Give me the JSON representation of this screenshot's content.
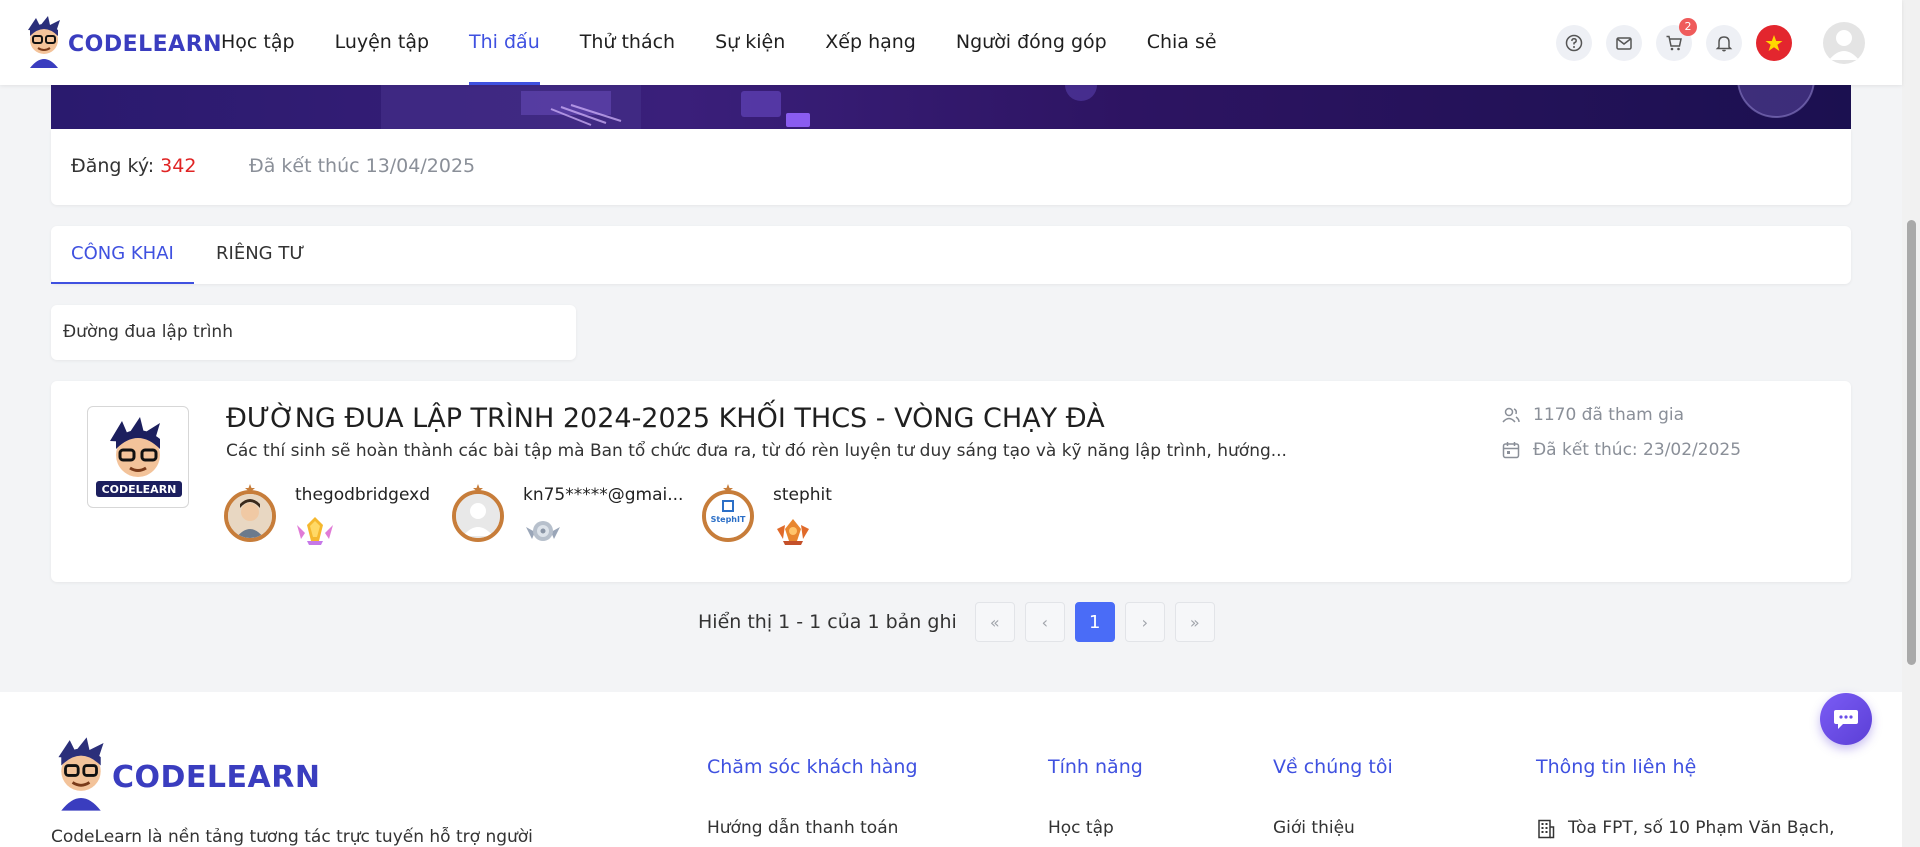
{
  "header": {
    "logo_text": "CODELEARN",
    "nav": [
      {
        "label": "Học tập"
      },
      {
        "label": "Luyện tập"
      },
      {
        "label": "Thi đấu",
        "active": true
      },
      {
        "label": "Thử thách"
      },
      {
        "label": "Sự kiện"
      },
      {
        "label": "Xếp hạng"
      },
      {
        "label": "Người đóng góp"
      },
      {
        "label": "Chia sẻ"
      }
    ],
    "cart_count": "2",
    "icons": [
      "help-icon",
      "mail-icon",
      "cart-icon",
      "bell-icon",
      "vn-flag-icon",
      "user-avatar-icon"
    ]
  },
  "registration": {
    "label": "Đăng ký:",
    "count": "342",
    "status": "Đã kết thúc 13/04/2025"
  },
  "tabs": [
    {
      "label": "CÔNG KHAI",
      "active": true
    },
    {
      "label": "RIÊNG TƯ"
    }
  ],
  "filter": {
    "value": "Đường đua lập trình"
  },
  "contest": {
    "title": "ĐƯỜNG ĐUA LẬP TRÌNH 2024-2025 KHỐI THCS - VÒNG CHẠY ĐÀ",
    "description": "Các thí sinh sẽ hoàn thành các bài tập mà Ban tổ chức đưa ra, từ đó rèn luyện tư duy sáng tạo và kỹ năng lập trình, hướng...",
    "participants": "1170 đã tham gia",
    "end_date": "Đã kết thúc: 23/02/2025",
    "winners": [
      {
        "name": "thegodbridgexd",
        "medal": "gold"
      },
      {
        "name": "kn75*****@gmai...",
        "medal": "silver"
      },
      {
        "name": "stephit",
        "medal": "bronze"
      }
    ]
  },
  "pagination": {
    "info": "Hiển thị 1 - 1 của 1 bản ghi",
    "current_page": "1",
    "first": "«",
    "prev": "‹",
    "next": "›",
    "last": "»"
  },
  "footer": {
    "logo_text": "CODELEARN",
    "about": "CodeLearn là nền tảng tương tác trực tuyến hỗ trợ người",
    "columns": [
      {
        "title": "Chăm sóc khách hàng",
        "first_link": "Hướng dẫn thanh toán"
      },
      {
        "title": "Tính năng",
        "first_link": "Học tập"
      },
      {
        "title": "Về chúng tôi",
        "first_link": "Giới thiệu"
      },
      {
        "title": "Thông tin liên hệ",
        "first_link": "Tòa FPT, số 10 Phạm Văn Bạch,"
      }
    ]
  },
  "colors": {
    "accent": "#3f51e0",
    "danger": "#e02424",
    "page_active": "#4a6cf7"
  }
}
